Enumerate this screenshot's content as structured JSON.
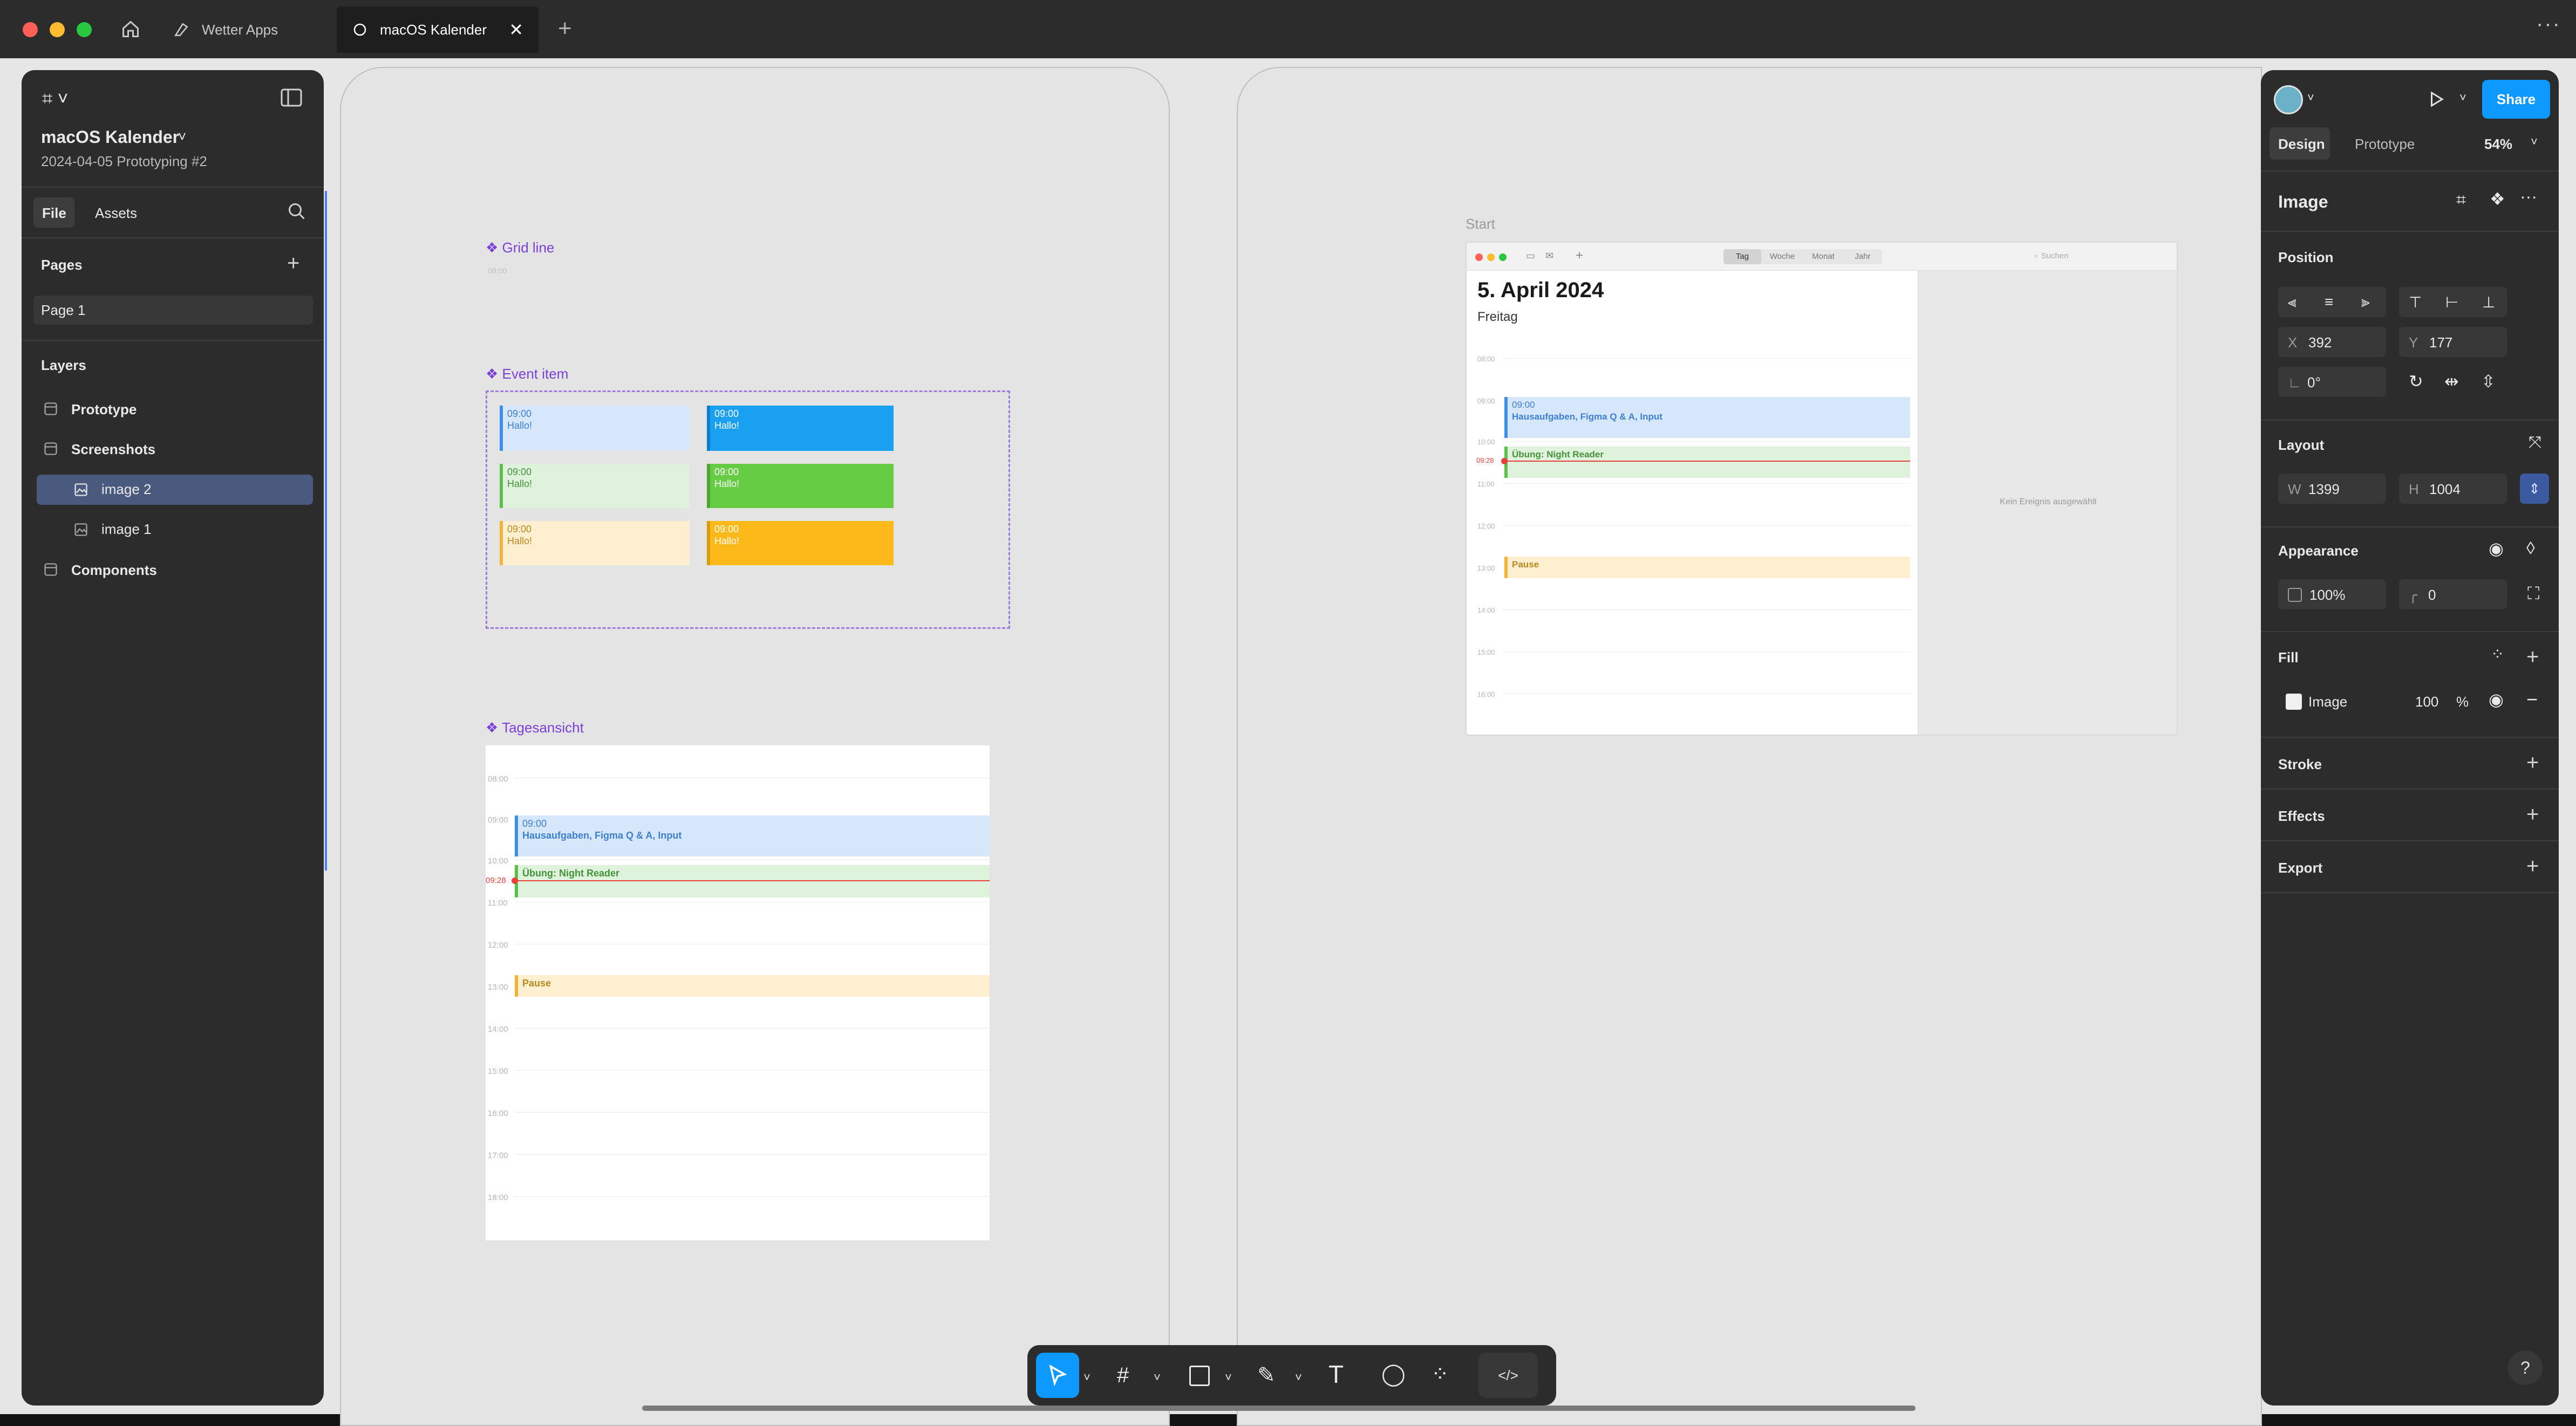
{
  "tabs": [
    {
      "label": "Wetter Apps"
    },
    {
      "label": "macOS Kalender"
    }
  ],
  "left_panel": {
    "file_title": "macOS Kalender",
    "file_subtitle": "2024-04-05 Prototyping #2",
    "tab_file": "File",
    "tab_assets": "Assets",
    "pages_header": "Pages",
    "page_item": "Page 1",
    "layers_header": "Layers",
    "layers": [
      {
        "label": "Prototype"
      },
      {
        "label": "Screenshots"
      },
      {
        "label": "image 2"
      },
      {
        "label": "image 1"
      },
      {
        "label": "Components"
      }
    ]
  },
  "components": {
    "grid_line": "Grid line",
    "event_item": "Event item",
    "tagesansicht": "Tagesansicht",
    "event_items": [
      {
        "time": "09:00",
        "text": "Hallo!"
      },
      {
        "time": "09:00",
        "text": "Hallo!"
      },
      {
        "time": "09:00",
        "text": "Hallo!"
      },
      {
        "time": "09:00",
        "text": "Hallo!"
      },
      {
        "time": "09:00",
        "text": "Hallo!"
      },
      {
        "time": "09:00",
        "text": "Hallo!"
      }
    ],
    "day_events": {
      "e1_time": "09:00",
      "e1_text": "Hausaufgaben, Figma Q & A, Input",
      "e2_text": "Übung: Night Reader",
      "e3_text": "Pause",
      "now": "09:28"
    }
  },
  "start_frame": {
    "label": "Start",
    "segments": [
      "Tag",
      "Woche",
      "Monat",
      "Jahr"
    ],
    "search": "Suchen",
    "date": "5. April 2024",
    "weekday": "Freitag",
    "e1_time": "09:00",
    "e1_text": "Hausaufgaben, Figma Q & A, Input",
    "e2_text": "Übung: Night Reader",
    "e3_text": "Pause",
    "now": "09:28",
    "empty": "Kein Ereignis ausgewählt"
  },
  "right_panel": {
    "share": "Share",
    "tab_design": "Design",
    "tab_prototype": "Prototype",
    "zoom": "54%",
    "image_title": "Image",
    "position": "Position",
    "x_label": "X",
    "x_value": "392",
    "y_label": "Y",
    "y_value": "177",
    "rotation": "0°",
    "layout": "Layout",
    "w_label": "W",
    "w_value": "1399",
    "h_label": "H",
    "h_value": "1004",
    "appearance": "Appearance",
    "opacity": "100%",
    "radius": "0",
    "fill": "Fill",
    "fill_label": "Image",
    "fill_opacity": "100",
    "fill_unit": "%",
    "stroke": "Stroke",
    "effects": "Effects",
    "export": "Export"
  },
  "toolbar": {
    "code": "</>"
  },
  "help": "?",
  "colors": {
    "accent": "#0d99ff",
    "component": "#7b40d8",
    "event_blue": "#d6e7fb",
    "event_green": "#dff3dc",
    "event_orange": "#fdefd0"
  }
}
